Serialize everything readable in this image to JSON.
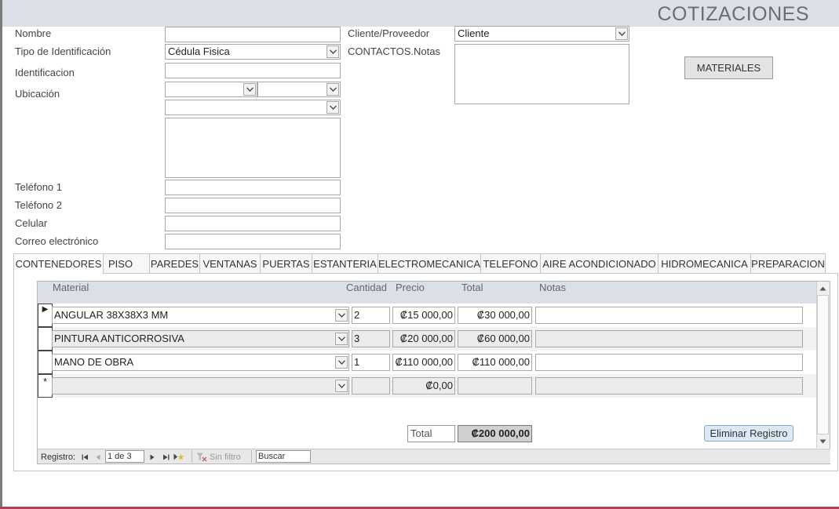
{
  "form": {
    "title": "COTIZACIONES"
  },
  "contact": {
    "labels": {
      "nombre": "Nombre",
      "tipo_id": "Tipo de Identificación",
      "identificacion": "Identificacion",
      "ubicacion": "Ubicación",
      "telefono1": "Teléfono 1",
      "telefono2": "Teléfono 2",
      "celular": "Celular",
      "correo": "Correo electrónico",
      "cliente_proveedor": "Cliente/Proveedor",
      "notas": "CONTACTOS.Notas"
    },
    "values": {
      "tipo_id": "Cédula Fisica",
      "cliente_proveedor": "Cliente"
    }
  },
  "buttons": {
    "materiales": "MATERIALES",
    "eliminar": "Eliminar Registro"
  },
  "tabs": [
    "CONTENEDORES",
    "PISO",
    "PAREDES",
    "VENTANAS",
    "PUERTAS",
    "ESTANTERIA",
    "ELECTROMECANICA",
    "TELEFONO",
    "AIRE ACONDICIONADO",
    "HIDROMECANICA",
    "PREPARACION"
  ],
  "grid": {
    "columns": {
      "material": "Material",
      "cantidad": "Cantidad",
      "precio": "Precio",
      "total": "Total",
      "notas": "Notas"
    },
    "rows": [
      {
        "material": "ANGULAR 38X38X3 MM",
        "cantidad": "2",
        "precio": "₡15 000,00",
        "total": "₡30 000,00"
      },
      {
        "material": "PINTURA ANTICORROSIVA",
        "cantidad": "3",
        "precio": "₡20 000,00",
        "total": "₡60 000,00"
      },
      {
        "material": "MANO DE OBRA",
        "cantidad": "1",
        "precio": "₡110 000,00",
        "total": "₡110 000,00"
      }
    ],
    "new_row": {
      "precio": "₡0,00",
      "marker": "*"
    },
    "current_marker": "▶",
    "total_label": "Total",
    "total_value": "₡200 000,00"
  },
  "navigator": {
    "label": "Registro:",
    "position": "1 de 3",
    "filter": "Sin filtro",
    "search": "Buscar"
  }
}
